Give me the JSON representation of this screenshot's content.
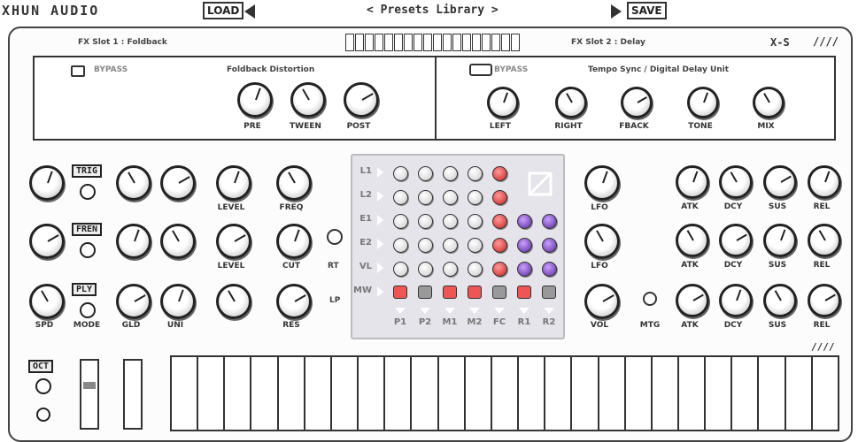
{
  "header": {
    "brand": "XHUN AUDIO",
    "load_label": "LOAD",
    "preset_label": "< Presets Library >",
    "save_label": "SAVE"
  },
  "top_strip": {
    "fx1_label": "FX Slot 1 : Foldback",
    "fx2_label": "FX Slot 2 : Delay",
    "model_label": "X-S"
  },
  "fx1": {
    "toggle_label": "BYPASS",
    "title": "Foldback Distortion",
    "knobs": [
      "PRE",
      "TWEEN",
      "POST"
    ]
  },
  "fx2": {
    "toggle_label": "BYPASS",
    "title": "Tempo Sync / Digital Delay Unit",
    "knobs": [
      "LEFT",
      "RIGHT",
      "FBACK",
      "TONE",
      "MIX"
    ]
  },
  "synth": {
    "row1_labels": [
      "",
      "",
      "",
      "",
      "LEVEL",
      "FREQ"
    ],
    "row2_labels": [
      "",
      "",
      "",
      "",
      "LEVEL",
      "CUT"
    ],
    "row3_labels": [
      "SPD",
      "MODE",
      "GLD",
      "UNI",
      "",
      "RES"
    ],
    "tags": [
      "TRIG",
      "FREN",
      "PLY"
    ],
    "mid_labels": [
      "RT",
      "LP"
    ],
    "right_labels": [
      "LFO",
      "LFO",
      "VOL",
      "MTG"
    ],
    "env_labels": [
      "ATK",
      "DCY",
      "SUS",
      "REL"
    ],
    "bottom_tag": "OCT"
  },
  "matrix": {
    "rows": [
      "L1",
      "L2",
      "E1",
      "E2",
      "VL",
      "MW"
    ],
    "columns": [
      "P1",
      "P2",
      "M1",
      "M2",
      "FC",
      "R1",
      "R2"
    ]
  }
}
